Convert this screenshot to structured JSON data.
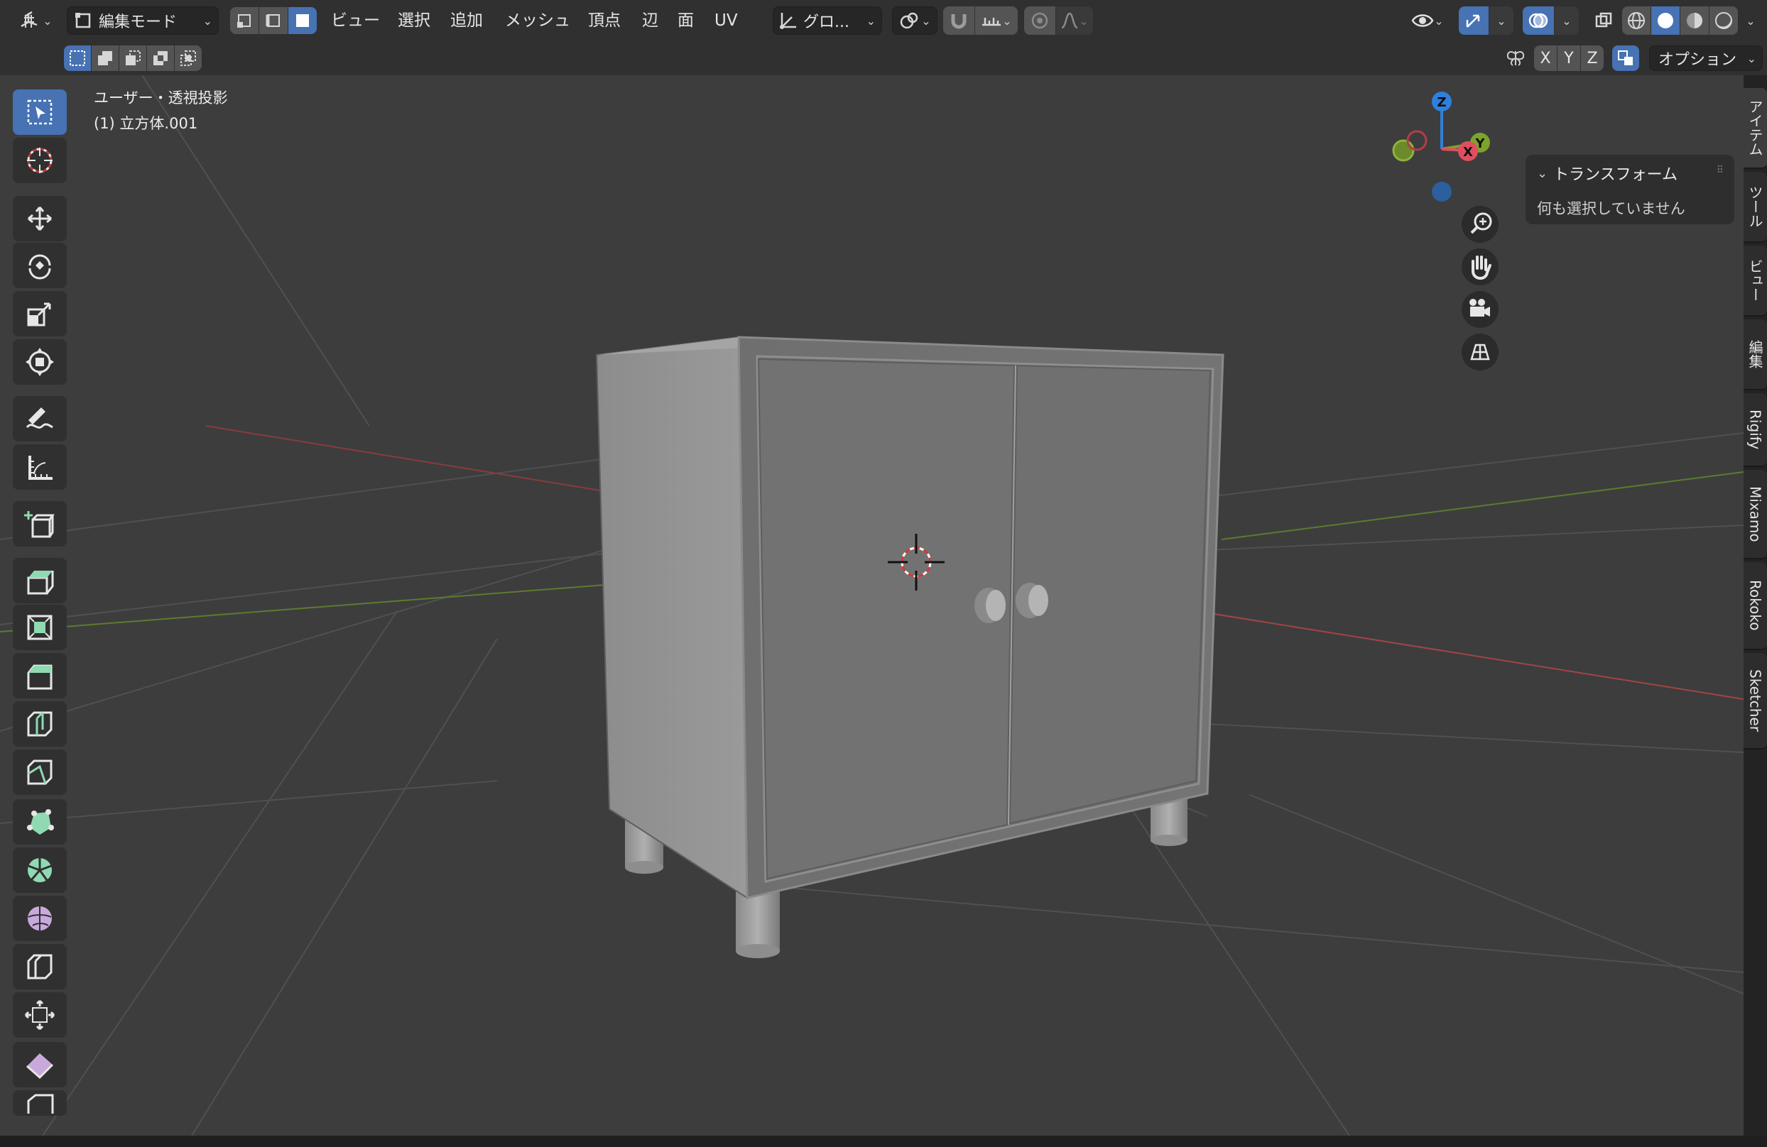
{
  "header": {
    "editor_type_icon": "3d-viewport-icon",
    "mode": "編集モード",
    "menu": [
      "ビュー",
      "選択",
      "追加",
      "メッシュ",
      "頂点",
      "辺",
      "面",
      "UV"
    ],
    "transform_orientation": "グロ...",
    "axes": [
      "X",
      "Y",
      "Z"
    ],
    "options_label": "オプション"
  },
  "viewport": {
    "view_name": "ユーザー・透視投影",
    "object_name": "(1) 立方体.001"
  },
  "gizmo": {
    "z": "Z",
    "y": "Y",
    "x": "X"
  },
  "npanel": {
    "section_title": "トランスフォーム",
    "message": "何も選択していません"
  },
  "sidebar_tabs": [
    "アイテム",
    "ツール",
    "ビュー",
    "編集",
    "Rigify",
    "Mixamo",
    "Rokoko",
    "Sketcher"
  ],
  "toolbar": {
    "active_tool": "select-box-icon"
  },
  "colors": {
    "accent": "#4772b3",
    "axis_x": "#e04f5f",
    "axis_y": "#7ca32a",
    "axis_z": "#2f7fdc",
    "header_bg": "#303030",
    "viewport_bg": "#3d3d3d"
  }
}
